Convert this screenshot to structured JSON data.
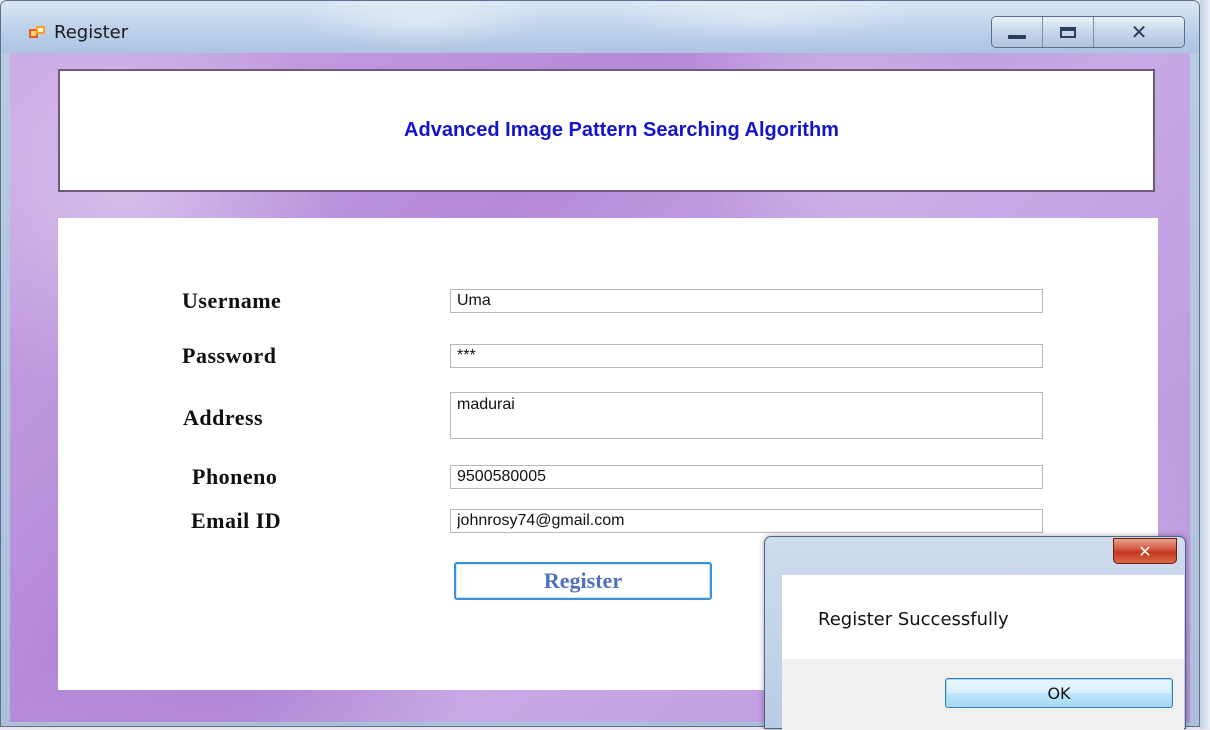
{
  "window": {
    "title": "Register",
    "icon": "app-form-icon",
    "controls": {
      "minimize": "minimize-icon",
      "maximize": "maximize-icon",
      "close": "close-icon"
    }
  },
  "header": {
    "title": "Advanced Image Pattern Searching Algorithm"
  },
  "form": {
    "fields": [
      {
        "label": "Username",
        "value": "Uma"
      },
      {
        "label": "Password",
        "value": "***"
      },
      {
        "label": "Address",
        "value": "madurai"
      },
      {
        "label": "Phoneno",
        "value": "9500580005"
      },
      {
        "label": "Email ID",
        "value": "johnrosy74@gmail.com"
      }
    ],
    "submit_label": "Register"
  },
  "message_box": {
    "text": "Register Successfully",
    "ok_label": "OK",
    "close_glyph": "✕"
  },
  "colors": {
    "header_text": "#1414cc",
    "client_background": "#b58ad9",
    "register_text": "#4f6fc2"
  }
}
